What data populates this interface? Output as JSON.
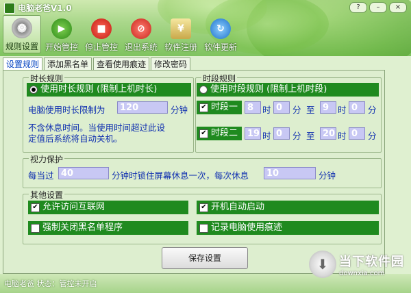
{
  "window": {
    "title": "电脑老爸V1.0",
    "controls": [
      "?",
      "–",
      "×"
    ]
  },
  "toolbar": [
    {
      "label": "规则设置",
      "icon": "gear-icon"
    },
    {
      "label": "开始管控",
      "icon": "play-icon"
    },
    {
      "label": "停止管控",
      "icon": "stop-icon"
    },
    {
      "label": "退出系统",
      "icon": "exit-icon"
    },
    {
      "label": "软件注册",
      "icon": "register-icon"
    },
    {
      "label": "软件更新",
      "icon": "update-icon"
    }
  ],
  "tabs": [
    "设置规则",
    "添加黑名单",
    "查看使用痕迹",
    "修改密码"
  ],
  "duration": {
    "title": "时长规则",
    "option": "使用时长规则 (限制上机时长)",
    "limit_label": "电脑使用时长限制为",
    "limit_value": "120",
    "limit_unit": "分钟",
    "note_line1": "不含休息时间。当使用时间超过此设",
    "note_line2": "定值后系统将自动关机。"
  },
  "period": {
    "title": "时段规则",
    "option": "使用时段规则 (限制上机时段)",
    "p1": {
      "label": "时段一",
      "h1": "8",
      "m1": "0",
      "h2": "9",
      "m2": "0"
    },
    "p2": {
      "label": "时段二",
      "h1": "19",
      "m1": "0",
      "h2": "20",
      "m2": "0"
    },
    "hour": "时",
    "minute": "分",
    "to": "至"
  },
  "vision": {
    "title": "视力保护",
    "prefix": "每当过",
    "interval": "40",
    "middle": "分钟时锁住屏幕休息一次，每次休息",
    "rest": "10",
    "suffix": "分钟"
  },
  "other": {
    "title": "其他设置",
    "allow_internet": "允许访问互联网",
    "autostart": "开机自动启动",
    "force_close": "强制关闭黑名单程序",
    "record": "记录电脑使用痕迹"
  },
  "save_label": "保存设置",
  "status": "电脑老爸  状态：管控未开启",
  "watermark": {
    "line1": "当下软件园",
    "line2": "downxia.com"
  }
}
